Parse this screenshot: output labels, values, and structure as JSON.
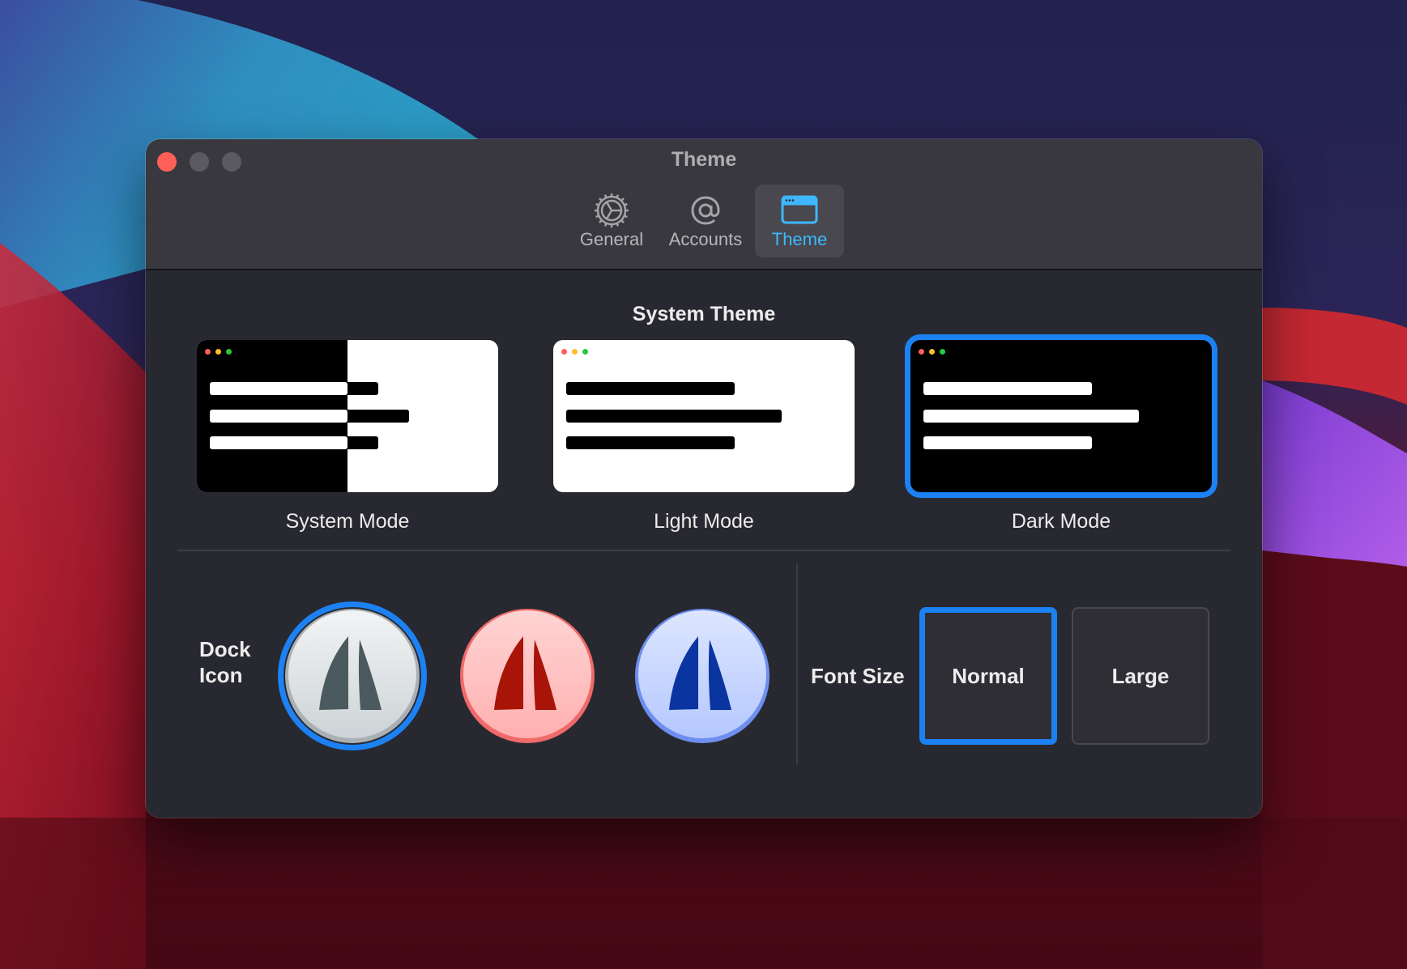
{
  "window": {
    "title": "Theme"
  },
  "toolbar": {
    "tabs": [
      {
        "label": "General",
        "icon": "gear-icon",
        "active": false
      },
      {
        "label": "Accounts",
        "icon": "at-icon",
        "active": false
      },
      {
        "label": "Theme",
        "icon": "window-icon",
        "active": true
      }
    ]
  },
  "system_theme": {
    "title": "System Theme",
    "options": [
      {
        "label": "System Mode",
        "selected": false
      },
      {
        "label": "Light Mode",
        "selected": false
      },
      {
        "label": "Dark Mode",
        "selected": true
      }
    ]
  },
  "dock_icon": {
    "label": "Dock Icon",
    "options": [
      {
        "name": "gray",
        "selected": true
      },
      {
        "name": "red",
        "selected": false
      },
      {
        "name": "blue",
        "selected": false
      }
    ]
  },
  "font_size": {
    "label": "Font Size",
    "options": [
      {
        "label": "Normal",
        "selected": true
      },
      {
        "label": "Large",
        "selected": false
      }
    ]
  },
  "colors": {
    "accent": "#1c82f4",
    "active_tab": "#3fb7ff",
    "close": "#fe5f57"
  }
}
